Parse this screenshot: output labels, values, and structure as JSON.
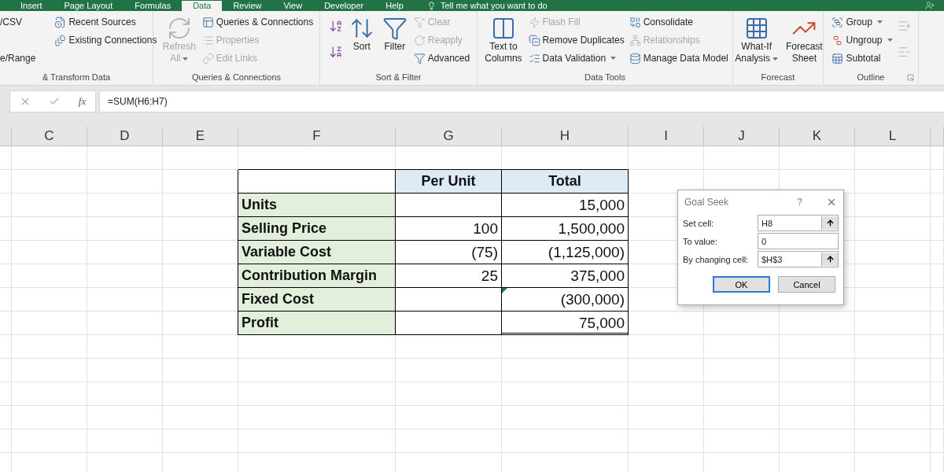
{
  "ribbon_tabs": [
    {
      "label": "Insert",
      "selected": false
    },
    {
      "label": "Page Layout",
      "selected": false
    },
    {
      "label": "Formulas",
      "selected": false
    },
    {
      "label": "Data",
      "selected": true
    },
    {
      "label": "Review",
      "selected": false
    },
    {
      "label": "View",
      "selected": false
    },
    {
      "label": "Developer",
      "selected": false
    },
    {
      "label": "Help",
      "selected": false
    }
  ],
  "tell_me": "Tell me what you want to do",
  "ribbon_groups": [
    {
      "label": "& Transform Data",
      "columns": [
        {
          "kind": "stack",
          "items": [
            {
              "kind": "label",
              "label": "/CSV",
              "disabled": false
            },
            {
              "kind": "label",
              "label": "e/Range",
              "disabled": false
            }
          ]
        },
        {
          "kind": "stack",
          "items": [
            {
              "kind": "icon-label",
              "label": "Recent Sources",
              "disabled": false
            },
            {
              "kind": "icon-label",
              "label": "Existing Connections",
              "disabled": false
            }
          ]
        }
      ]
    },
    {
      "label": "Queries & Connections",
      "columns": [
        {
          "kind": "large",
          "lines": [
            "Refresh",
            "All"
          ],
          "disabled": true,
          "dropdown": true
        },
        {
          "kind": "stack",
          "items": [
            {
              "kind": "icon-label",
              "label": "Queries & Connections",
              "disabled": false
            },
            {
              "kind": "icon-label",
              "label": "Properties",
              "disabled": true
            },
            {
              "kind": "icon-label",
              "label": "Edit Links",
              "disabled": true
            }
          ]
        }
      ]
    },
    {
      "label": "Sort & Filter",
      "columns": [
        {
          "kind": "stack",
          "items": [
            {
              "kind": "icon",
              "disabled": false
            },
            {
              "kind": "icon",
              "disabled": false
            }
          ]
        },
        {
          "kind": "large",
          "lines": [
            "Sort"
          ],
          "disabled": false,
          "dropdown": false
        },
        {
          "kind": "large",
          "lines": [
            "Filter"
          ],
          "disabled": false,
          "dropdown": false
        },
        {
          "kind": "stack",
          "items": [
            {
              "kind": "icon-label",
              "label": "Clear",
              "disabled": true
            },
            {
              "kind": "icon-label",
              "label": "Reapply",
              "disabled": true
            },
            {
              "kind": "icon-label",
              "label": "Advanced",
              "disabled": false
            }
          ]
        }
      ]
    },
    {
      "label": "Data Tools",
      "columns": [
        {
          "kind": "large",
          "lines": [
            "Text to",
            "Columns"
          ],
          "disabled": false,
          "dropdown": false
        },
        {
          "kind": "stack",
          "items": [
            {
              "kind": "icon-label",
              "label": "Flash Fill",
              "disabled": true
            },
            {
              "kind": "icon-label",
              "label": "Remove Duplicates",
              "disabled": false
            },
            {
              "kind": "icon-label",
              "label": "Data Validation",
              "disabled": false,
              "dropdown": true
            }
          ]
        },
        {
          "kind": "stack",
          "items": [
            {
              "kind": "icon-label",
              "label": "Consolidate",
              "disabled": false
            },
            {
              "kind": "icon-label",
              "label": "Relationships",
              "disabled": true
            },
            {
              "kind": "icon-label",
              "label": "Manage Data Model",
              "disabled": false
            }
          ]
        }
      ]
    },
    {
      "label": "Forecast",
      "columns": [
        {
          "kind": "large",
          "lines": [
            "What-If",
            "Analysis"
          ],
          "disabled": false,
          "dropdown": true
        },
        {
          "kind": "large",
          "lines": [
            "Forecast",
            "Sheet"
          ],
          "disabled": false,
          "dropdown": false
        }
      ]
    },
    {
      "label": "Outline",
      "launcher": true,
      "columns": [
        {
          "kind": "stack",
          "items": [
            {
              "kind": "icon-label",
              "label": "Group",
              "disabled": false,
              "dropdown": true
            },
            {
              "kind": "icon-label",
              "label": "Ungroup",
              "disabled": false,
              "dropdown": true
            },
            {
              "kind": "icon-label",
              "label": "Subtotal",
              "disabled": false
            }
          ]
        },
        {
          "kind": "stack",
          "items": [
            {
              "kind": "icon",
              "disabled": true
            },
            {
              "kind": "icon",
              "disabled": true
            }
          ]
        }
      ]
    }
  ],
  "formula_bar": {
    "function_label": "fx",
    "formula": "=SUM(H6:H7)"
  },
  "column_headers": [
    "C",
    "D",
    "E",
    "F",
    "G",
    "H",
    "I",
    "J",
    "K",
    "L"
  ],
  "table": {
    "columns": [
      "Per Unit",
      "Total"
    ],
    "rows": [
      {
        "label": "Units",
        "total": "15,000",
        "error_flag": false,
        "double_underline": false
      },
      {
        "label": "Selling Price",
        "per_unit": "100",
        "total": "1,500,000",
        "error_flag": false,
        "double_underline": false
      },
      {
        "label": "Variable Cost",
        "per_unit": "(75)",
        "total": "(1,125,000)",
        "error_flag": false,
        "double_underline": false
      },
      {
        "label": "Contribution Margin",
        "per_unit": "25",
        "total": "375,000",
        "error_flag": false,
        "double_underline": false
      },
      {
        "label": "Fixed Cost",
        "total": "(300,000)",
        "error_flag": true,
        "double_underline": false
      },
      {
        "label": "Profit",
        "total": "75,000",
        "error_flag": false,
        "double_underline": true
      }
    ]
  },
  "dialog": {
    "title": "Goal Seek",
    "help": "?",
    "fields": [
      {
        "label": "Set cell:",
        "value": "H8",
        "kind": "ref"
      },
      {
        "label": "To value:",
        "value": "0",
        "kind": "plain"
      },
      {
        "label": "By changing cell:",
        "value": "$H$3",
        "kind": "ref"
      }
    ],
    "buttons": [
      {
        "label": "OK",
        "selected": true
      },
      {
        "label": "Cancel",
        "selected": false
      }
    ]
  }
}
